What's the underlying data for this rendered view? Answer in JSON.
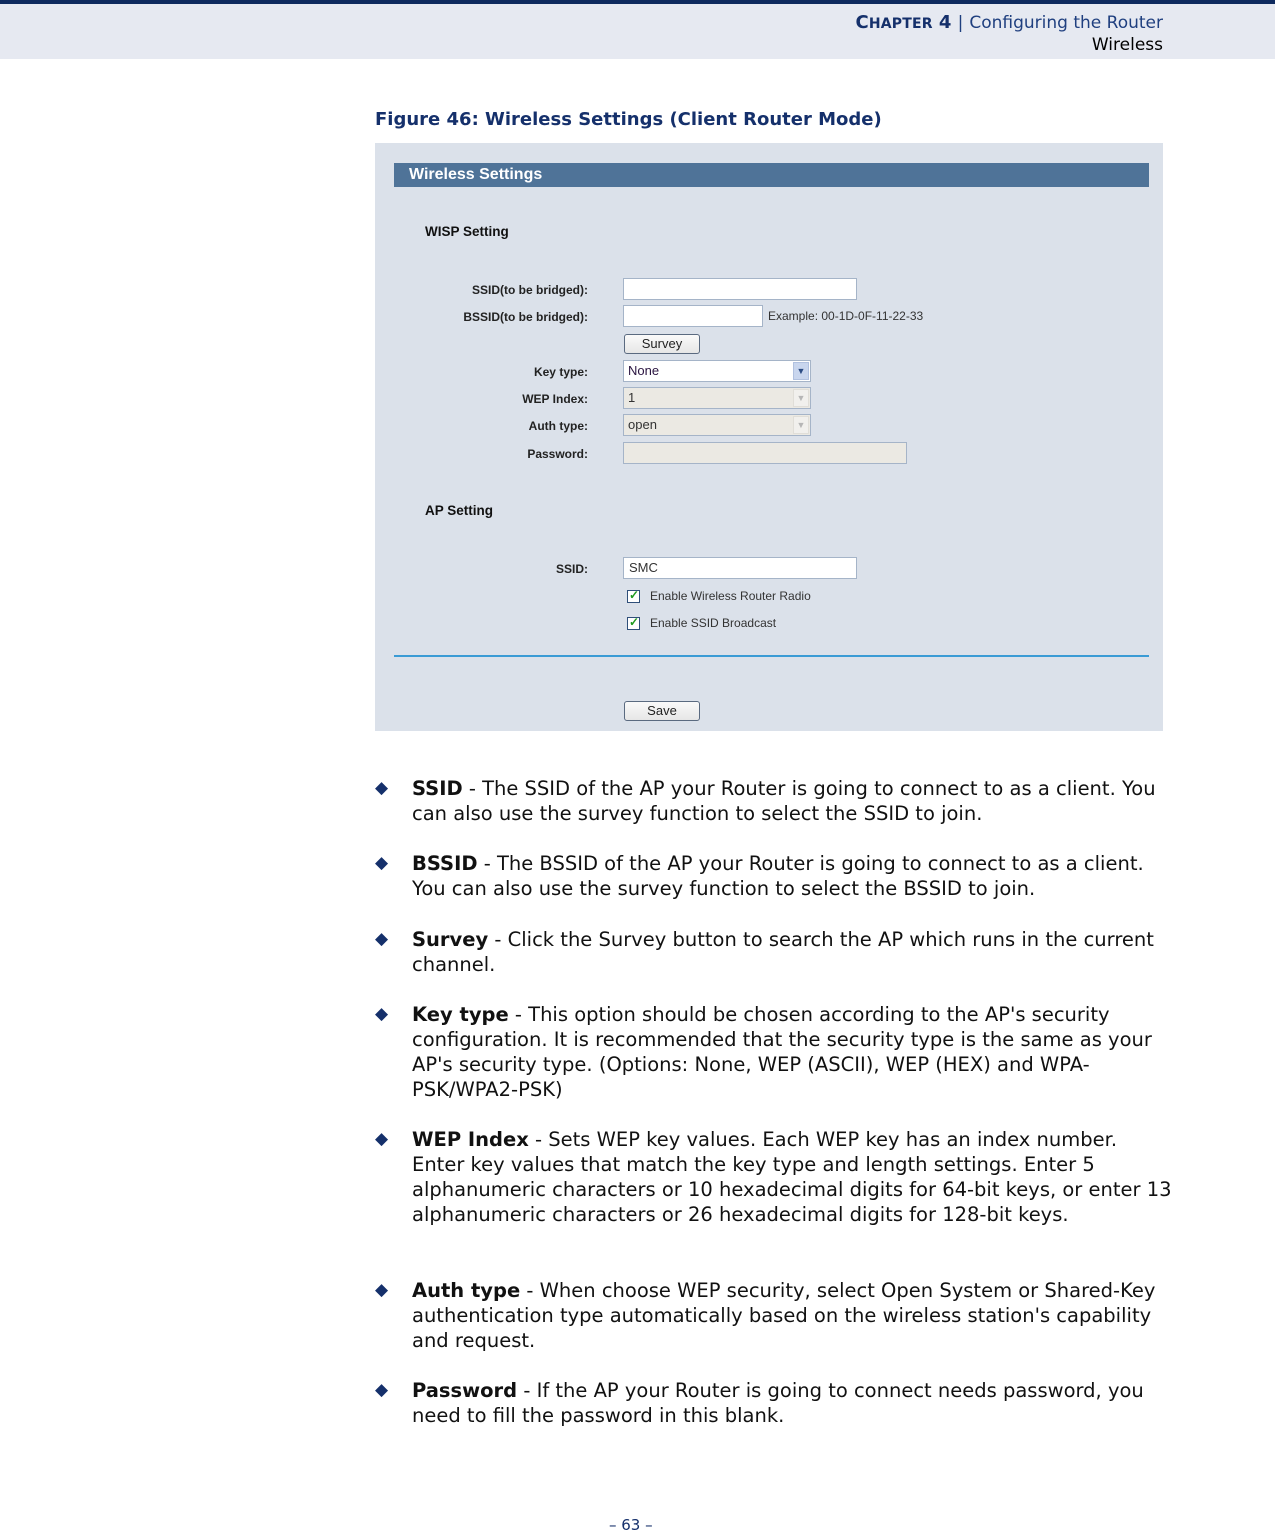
{
  "header": {
    "chapter_first": "C",
    "chapter_rest": "HAPTER",
    "chapter_num": "4",
    "separator": "|",
    "chapter_title": "Configuring the Router",
    "section": "Wireless"
  },
  "figure": {
    "caption": "Figure 46:  Wireless Settings (Client Router Mode)"
  },
  "screenshot": {
    "title": "Wireless Settings",
    "wisp_section": "WISP Setting",
    "ssid_bridged_label": "SSID(to be bridged):",
    "ssid_bridged_value": "",
    "bssid_bridged_label": "BSSID(to be bridged):",
    "bssid_bridged_value": "",
    "bssid_example": "Example: 00-1D-0F-11-22-33",
    "survey_button": "Survey",
    "key_type_label": "Key type:",
    "key_type_value": "None",
    "wep_index_label": "WEP Index:",
    "wep_index_value": "1",
    "auth_type_label": "Auth type:",
    "auth_type_value": "open",
    "password_label": "Password:",
    "password_value": "",
    "ap_section": "AP Setting",
    "ssid_label": "SSID:",
    "ssid_value": "SMC",
    "enable_radio_label": "Enable Wireless Router Radio",
    "enable_radio_checked": true,
    "enable_broadcast_label": "Enable SSID Broadcast",
    "enable_broadcast_checked": true,
    "save_button": "Save"
  },
  "bullets": [
    {
      "term": "SSID",
      "text": " -  The SSID of the AP your Router is going to connect to as a client. You can also use the survey function to select the SSID to join."
    },
    {
      "term": "BSSID",
      "text": " - The BSSID of the AP your Router is going to connect to as a client. You can also use the survey function to select the BSSID to join."
    },
    {
      "term": "Survey",
      "text": " - Click the Survey button to search the AP which runs in the current channel."
    },
    {
      "term": "Key type",
      "text": " - This option should be chosen according to the AP's security configuration. It is recommended that the security type is the same as your AP's security type. (Options: None, WEP (ASCII), WEP (HEX) and WPA-PSK/WPA2-PSK)"
    },
    {
      "term": "WEP Index",
      "text": " - Sets WEP key values. Each WEP key has an index number. Enter key values that match the key type and length settings. Enter 5 alphanumeric characters or 10 hexadecimal digits for 64-bit keys, or enter 13 alphanumeric characters or 26 hexadecimal digits for 128-bit keys."
    },
    {
      "term": "Auth type",
      "text": " - When choose WEP security, select Open System or Shared-Key authentication type automatically based on the wireless station's capability and request."
    },
    {
      "term": "Password",
      "text": " - If the AP your Router is going to connect needs password, you need to fill the password in this blank."
    }
  ],
  "bullet_glyph": "◆",
  "page_number": "–  63  –"
}
